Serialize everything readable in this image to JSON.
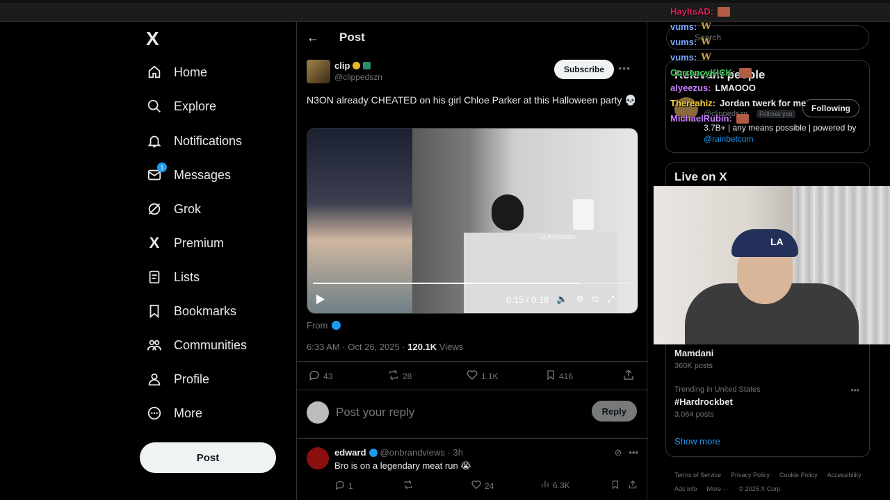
{
  "nav": {
    "logo": "X",
    "items": [
      {
        "label": "Home",
        "icon": "home-icon"
      },
      {
        "label": "Explore",
        "icon": "search-icon"
      },
      {
        "label": "Notifications",
        "icon": "bell-icon"
      },
      {
        "label": "Messages",
        "icon": "mail-icon",
        "badge": "1"
      },
      {
        "label": "Grok",
        "icon": "grok-icon"
      },
      {
        "label": "Premium",
        "icon": "x-premium-icon"
      },
      {
        "label": "Lists",
        "icon": "list-icon"
      },
      {
        "label": "Bookmarks",
        "icon": "bookmark-icon"
      },
      {
        "label": "Communities",
        "icon": "communities-icon"
      },
      {
        "label": "Profile",
        "icon": "person-icon"
      },
      {
        "label": "More",
        "icon": "more-circle-icon"
      }
    ],
    "post_label": "Post"
  },
  "header": {
    "title": "Post"
  },
  "post": {
    "author_name": "clip",
    "author_handle": "@clippedszn",
    "subscribe_label": "Subscribe",
    "text": "N3ON already CHEATED on his girl Chloe Parker at this Halloween party 💀",
    "video": {
      "time": "0:15 / 0:18",
      "progress": 0.83,
      "watermark": "CLIPPEDSZN"
    },
    "from_label": "From",
    "timestamp": "6:33 AM · Oct 26, 2025 · ",
    "views_count": "120.1K",
    "views_label": " Views",
    "stats": {
      "replies": "43",
      "reposts": "28",
      "likes": "1.1K",
      "bookmarks": "416"
    }
  },
  "reply": {
    "placeholder": "Post your reply",
    "button_label": "Reply"
  },
  "comment": {
    "name": "edward",
    "handle": "@onbrandviews · 3h",
    "text": "Bro is on a legendary meat run 😭",
    "replies": "1",
    "likes": "24",
    "views": "6.3K"
  },
  "sidebar": {
    "search_placeholder": "Search",
    "relevant_title": "Relevant people",
    "rp_handle": "@clippedszn",
    "rp_follows_you": "Follows you",
    "following_label": "Following",
    "rp_bio": "3.7B+ | any means possible | powered by ",
    "rp_mention": "@rainbetcom",
    "live_title": "Live on X",
    "trends": [
      {
        "context": "",
        "name": "Mamdani",
        "count": "360K posts"
      },
      {
        "context": "Trending in United States",
        "name": "#Hardrockbet",
        "count": "3,064 posts"
      }
    ],
    "show_more": "Show more",
    "footer": [
      "Terms of Service",
      "Privacy Policy",
      "Cookie Policy",
      "Accessibility",
      "Ads info",
      "More ···",
      "© 2025 X Corp."
    ]
  },
  "chat": [
    {
      "user": "HayItsAD:",
      "color": "#e0245e",
      "msg": ""
    },
    {
      "user": "vums:",
      "color": "#7aa7ff",
      "msg": "W"
    },
    {
      "user": "vums:",
      "color": "#7aa7ff",
      "msg": "W"
    },
    {
      "user": "vums:",
      "color": "#7aa7ff",
      "msg": "W"
    },
    {
      "user": "CurrencyKICK:",
      "color": "#39d353",
      "msg": ""
    },
    {
      "user": "alyeezus:",
      "color": "#c77dff",
      "msg": "LMAOOO"
    },
    {
      "user": "Thereahiz:",
      "color": "#f5d142",
      "msg": "Jordan twerk for me"
    },
    {
      "user": "MichaelRubin:",
      "color": "#c77dff",
      "msg": ""
    }
  ]
}
